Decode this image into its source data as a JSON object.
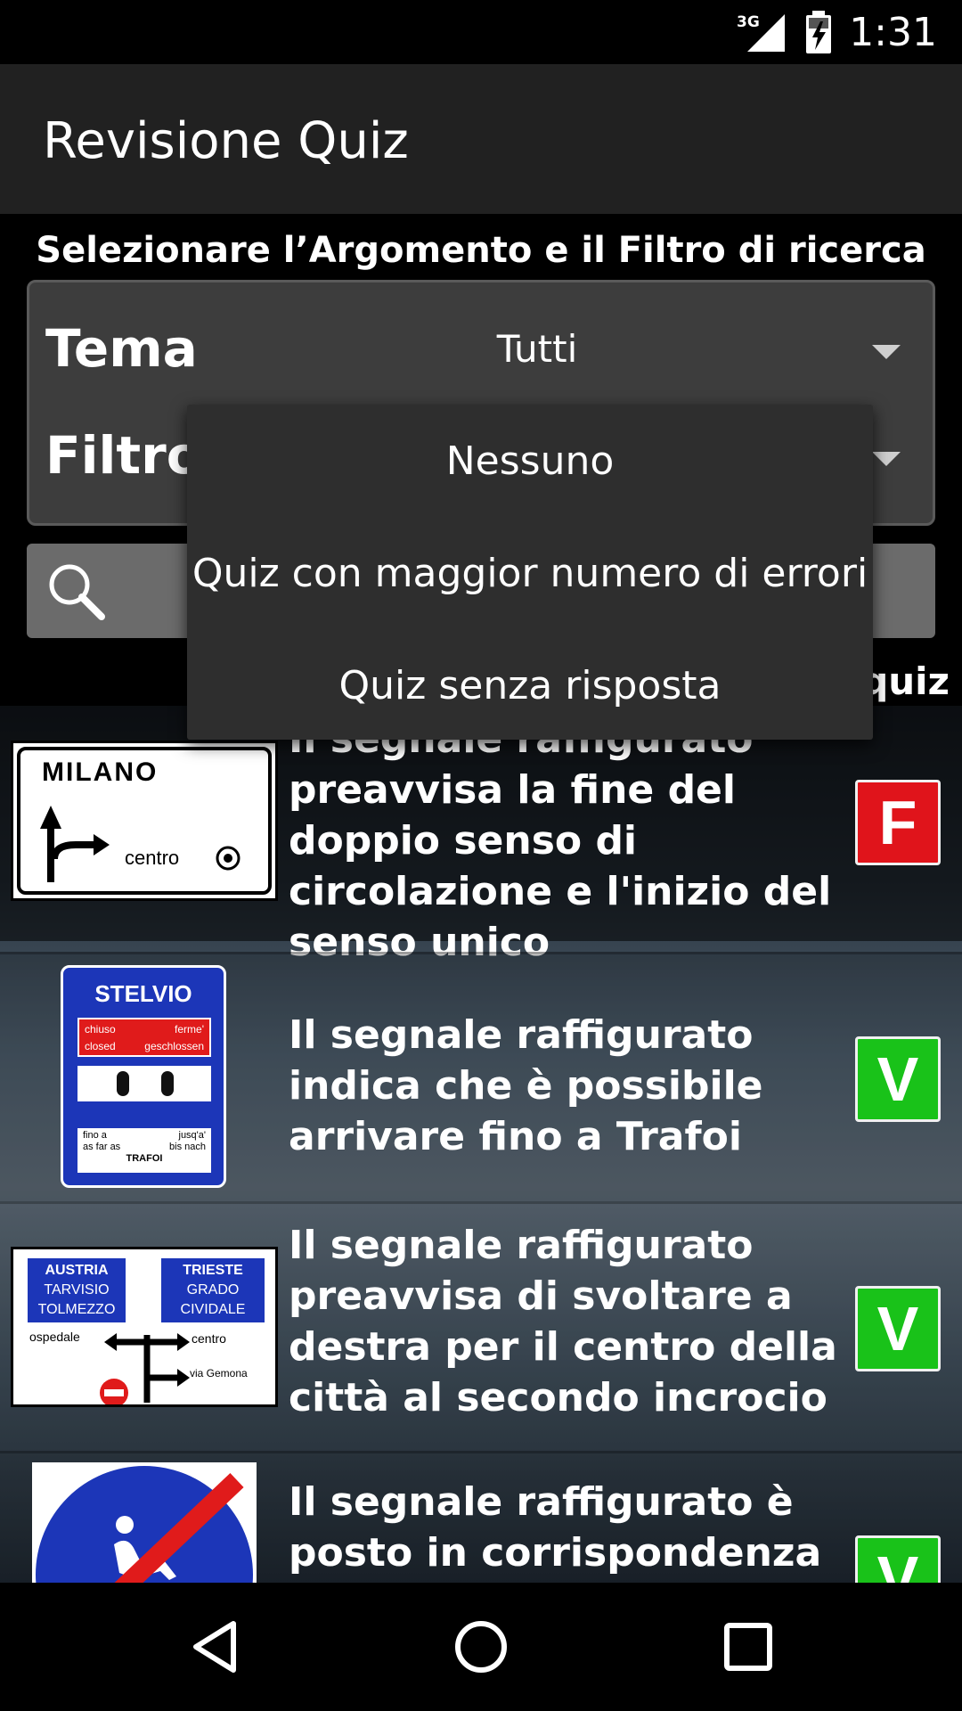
{
  "status_bar": {
    "network": "3G",
    "time": "1:31"
  },
  "app": {
    "title": "Revisione Quiz"
  },
  "filters": {
    "instruction": "Selezionare l’Argomento e il Filtro di ricerca",
    "tema_label": "Tema",
    "tema_value": "Tutti",
    "filtro_label": "Filtro",
    "search_placeholder": "",
    "count_label": "quiz"
  },
  "dropdown": {
    "options": [
      "Nessuno",
      "Quiz con maggior numero di errori",
      "Quiz senza risposta"
    ]
  },
  "quiz_list": [
    {
      "text": "Il segnale raffigurato preavvisa la fine del doppio senso di circolazione e l'inizio del senso unico",
      "answer": "F",
      "sign": {
        "line1": "MILANO",
        "line2": "centro"
      }
    },
    {
      "text": "Il segnale raffigurato indica che è possibile arrivare fino a Trafoi",
      "answer": "V",
      "sign": {
        "title": "STELVIO",
        "red_left": "chiuso",
        "red_right": "ferme'",
        "red_left2": "closed",
        "red_right2": "geschlossen",
        "b1": "fino a",
        "b2": "jusq'a'",
        "b3": "as far as",
        "b4": "bis nach",
        "b5": "TRAFOI"
      }
    },
    {
      "text": "Il segnale raffigurato preavvisa di svoltare a destra per il centro della città al secondo incrocio",
      "answer": "V",
      "sign": {
        "l1": "AUSTRIA",
        "l2": "TARVISIO",
        "l3": "TOLMEZZO",
        "r1": "TRIESTE",
        "r2": "GRADO",
        "r3": "CIVIDALE",
        "ospedale": "ospedale",
        "centro": "centro",
        "gemona": "via Gemona"
      }
    },
    {
      "text": "Il segnale raffigurato è posto in corrispondenza della fine",
      "answer": "V",
      "sign": {}
    }
  ],
  "colors": {
    "false_badge": "#e0141b",
    "true_badge": "#19c219",
    "action_bar": "#212121",
    "filter_box": "#3d3d3d",
    "popup": "#2e2e2e"
  }
}
